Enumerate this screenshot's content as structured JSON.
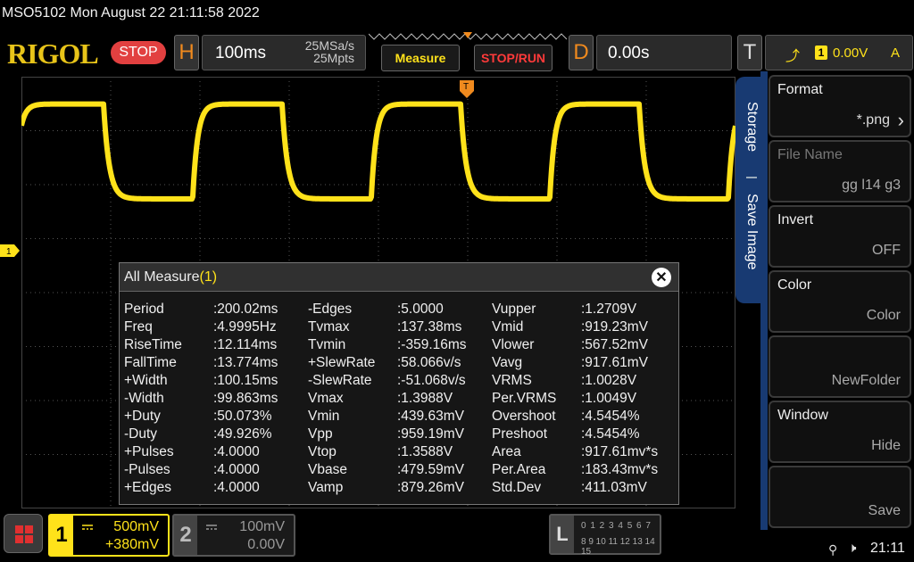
{
  "status_line": "MSO5102  Mon August 22 21:11:58 2022",
  "header": {
    "logo": "RIGOL",
    "run_state": "STOP",
    "horizontal": {
      "letter": "H",
      "timebase": "100ms",
      "sample_rate": "25MSa/s",
      "memory_depth": "25Mpts"
    },
    "measure_label": "Measure",
    "stoprun_label": "STOP/RUN",
    "delay": {
      "letter": "D",
      "value": "0.00s"
    },
    "trigger": {
      "letter": "T",
      "source": "1",
      "level": "0.00V",
      "mode": "A",
      "icon": "rising-edge-icon"
    }
  },
  "waveform": {
    "color": "#ffe21a",
    "type": "square",
    "period_ms": 200.02,
    "duty_percent": 50.073,
    "high_v": 1.3588,
    "low_v": 0.47959,
    "rise_time_ms": 12.114,
    "fall_time_ms": 13.774,
    "time_per_div_ms": 100,
    "volts_per_div": 0.5,
    "offset_v": 0.38,
    "channel_marker": "1"
  },
  "measure_panel": {
    "title": "All Measure",
    "channel": "(1)",
    "rows": [
      [
        {
          "n": "Period",
          "v": ":200.02ms"
        },
        {
          "n": "-Edges",
          "v": ":5.0000"
        },
        {
          "n": "Vupper",
          "v": ":1.2709V"
        }
      ],
      [
        {
          "n": "Freq",
          "v": ":4.9995Hz"
        },
        {
          "n": "Tvmax",
          "v": ":137.38ms"
        },
        {
          "n": "Vmid",
          "v": ":919.23mV"
        }
      ],
      [
        {
          "n": "RiseTime",
          "v": ":12.114ms"
        },
        {
          "n": "Tvmin",
          "v": ":-359.16ms"
        },
        {
          "n": "Vlower",
          "v": ":567.52mV"
        }
      ],
      [
        {
          "n": "FallTime",
          "v": ":13.774ms"
        },
        {
          "n": "+SlewRate",
          "v": ":58.066v/s"
        },
        {
          "n": "Vavg",
          "v": ":917.61mV"
        }
      ],
      [
        {
          "n": "+Width",
          "v": ":100.15ms"
        },
        {
          "n": "-SlewRate",
          "v": ":-51.068v/s"
        },
        {
          "n": "VRMS",
          "v": ":1.0028V"
        }
      ],
      [
        {
          "n": "-Width",
          "v": ":99.863ms"
        },
        {
          "n": "Vmax",
          "v": ":1.3988V"
        },
        {
          "n": "Per.VRMS",
          "v": ":1.0049V"
        }
      ],
      [
        {
          "n": "+Duty",
          "v": ":50.073%"
        },
        {
          "n": "Vmin",
          "v": ":439.63mV"
        },
        {
          "n": "Overshoot",
          "v": ":4.5454%"
        }
      ],
      [
        {
          "n": "-Duty",
          "v": ":49.926%"
        },
        {
          "n": "Vpp",
          "v": ":959.19mV"
        },
        {
          "n": "Preshoot",
          "v": ":4.5454%"
        }
      ],
      [
        {
          "n": "+Pulses",
          "v": ":4.0000"
        },
        {
          "n": "Vtop",
          "v": ":1.3588V"
        },
        {
          "n": "Area",
          "v": ":917.61mv*s"
        }
      ],
      [
        {
          "n": "-Pulses",
          "v": ":4.0000"
        },
        {
          "n": "Vbase",
          "v": ":479.59mV"
        },
        {
          "n": "Per.Area",
          "v": ":183.43mv*s"
        }
      ],
      [
        {
          "n": "+Edges",
          "v": ":4.0000"
        },
        {
          "n": "Vamp",
          "v": ":879.26mV"
        },
        {
          "n": "Std.Dev",
          "v": ":411.03mV"
        }
      ]
    ]
  },
  "side_tabs": {
    "storage": "Storage",
    "save_image": "Save Image"
  },
  "side_menu": [
    {
      "title": "Format",
      "value": "*.png"
    },
    {
      "title": "File Name",
      "value": "gg l14 g3"
    },
    {
      "title": "Invert",
      "value": "OFF"
    },
    {
      "title": "Color",
      "value": "Color"
    },
    {
      "title": "",
      "value": "NewFolder"
    },
    {
      "title": "Window",
      "value": "Hide"
    },
    {
      "title": "",
      "value": "Save"
    }
  ],
  "bottom": {
    "ch1": {
      "num": "1",
      "scale": "500mV",
      "offset": "+380mV"
    },
    "ch2": {
      "num": "2",
      "scale": "100mV",
      "offset": "0.00V"
    },
    "la": {
      "letter": "L",
      "row1": "0 1 2 3   4 5 6 7",
      "row2": "8 9 10 11  12 13 14 15"
    },
    "clock": "21:11"
  }
}
